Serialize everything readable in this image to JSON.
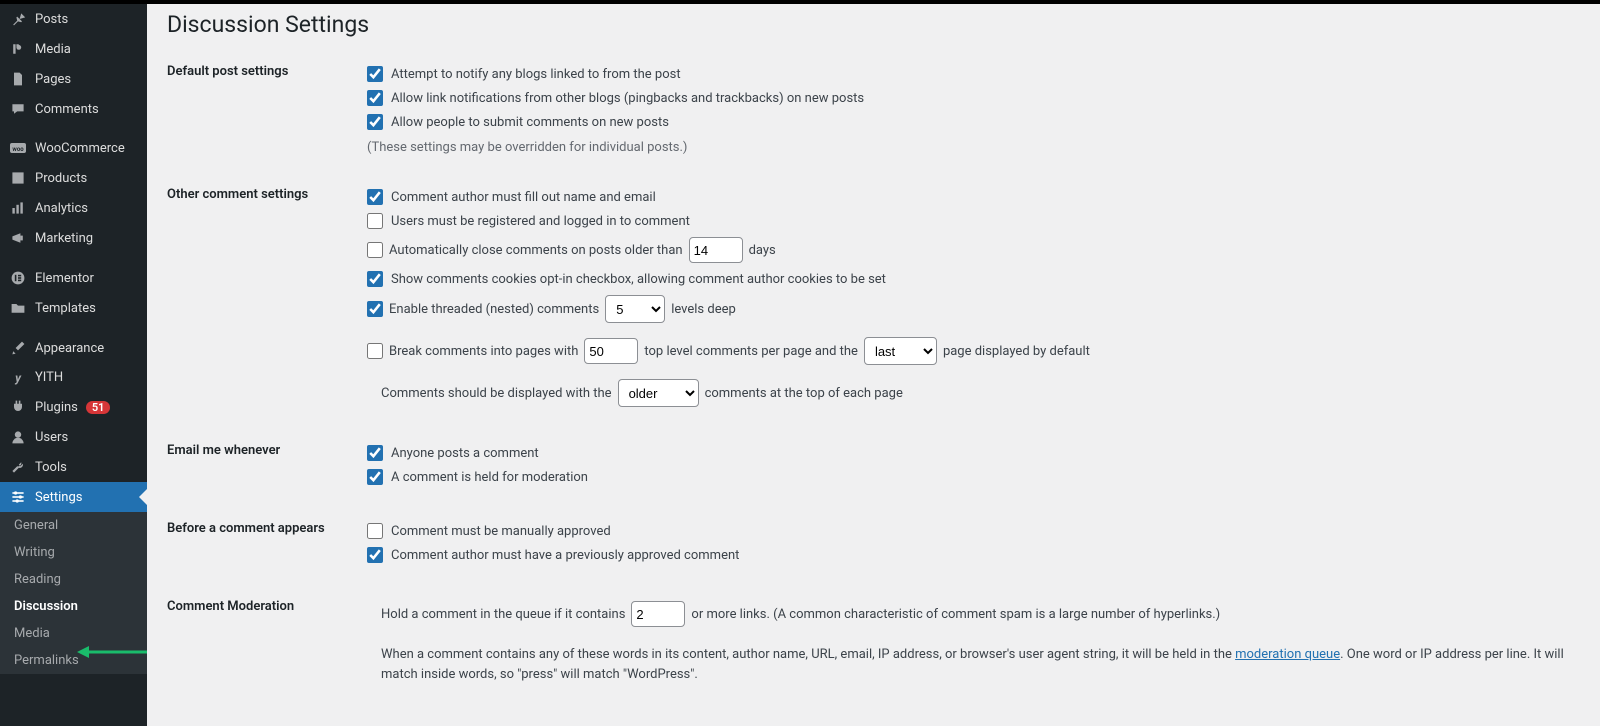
{
  "sidebar": {
    "items": [
      {
        "icon": "pin",
        "label": "Posts"
      },
      {
        "icon": "media",
        "label": "Media"
      },
      {
        "icon": "page",
        "label": "Pages"
      },
      {
        "icon": "comment",
        "label": "Comments"
      }
    ],
    "items2": [
      {
        "icon": "woo",
        "label": "WooCommerce"
      },
      {
        "icon": "products",
        "label": "Products"
      },
      {
        "icon": "analytics",
        "label": "Analytics"
      },
      {
        "icon": "marketing",
        "label": "Marketing"
      }
    ],
    "items3": [
      {
        "icon": "elementor",
        "label": "Elementor"
      },
      {
        "icon": "templates",
        "label": "Templates"
      }
    ],
    "items4": [
      {
        "icon": "appearance",
        "label": "Appearance"
      },
      {
        "icon": "yith",
        "label": "YITH"
      },
      {
        "icon": "plugins",
        "label": "Plugins",
        "badge": "51"
      },
      {
        "icon": "users",
        "label": "Users"
      },
      {
        "icon": "tools",
        "label": "Tools"
      }
    ],
    "settings": {
      "label": "Settings"
    },
    "sub": [
      "General",
      "Writing",
      "Reading",
      "Discussion",
      "Media",
      "Permalinks"
    ],
    "sub_current": "Discussion"
  },
  "page": {
    "title": "Discussion Settings"
  },
  "sections": {
    "default_post": {
      "label": "Default post settings",
      "opts": [
        {
          "checked": true,
          "text": "Attempt to notify any blogs linked to from the post"
        },
        {
          "checked": true,
          "text": "Allow link notifications from other blogs (pingbacks and trackbacks) on new posts"
        },
        {
          "checked": true,
          "text": "Allow people to submit comments on new posts"
        }
      ],
      "desc": "(These settings may be overridden for individual posts.)"
    },
    "other": {
      "label": "Other comment settings",
      "name_email": {
        "checked": true,
        "text": "Comment author must fill out name and email"
      },
      "registered": {
        "checked": false,
        "text": "Users must be registered and logged in to comment"
      },
      "autoclose": {
        "checked": false,
        "pre": "Automatically close comments on posts older than",
        "value": "14",
        "post": "days"
      },
      "cookies": {
        "checked": true,
        "text": "Show comments cookies opt-in checkbox, allowing comment author cookies to be set"
      },
      "threaded": {
        "checked": true,
        "pre": "Enable threaded (nested) comments",
        "value": "5",
        "post": "levels deep"
      },
      "pages": {
        "checked": false,
        "pre": "Break comments into pages with",
        "value": "50",
        "mid": "top level comments per page and the",
        "sel": "last",
        "post": "page displayed by default"
      },
      "order": {
        "pre": "Comments should be displayed with the",
        "sel": "older",
        "post": "comments at the top of each page"
      }
    },
    "email": {
      "label": "Email me whenever",
      "opts": [
        {
          "checked": true,
          "text": "Anyone posts a comment"
        },
        {
          "checked": true,
          "text": "A comment is held for moderation"
        }
      ]
    },
    "before": {
      "label": "Before a comment appears",
      "opts": [
        {
          "checked": false,
          "text": "Comment must be manually approved"
        },
        {
          "checked": true,
          "text": "Comment author must have a previously approved comment"
        }
      ]
    },
    "moderation": {
      "label": "Comment Moderation",
      "hold_pre": "Hold a comment in the queue if it contains",
      "hold_value": "2",
      "hold_post": "or more links. (A common characteristic of comment spam is a large number of hyperlinks.)",
      "long_pre": "When a comment contains any of these words in its content, author name, URL, email, IP address, or browser's user agent string, it will be held in the ",
      "link": "moderation queue",
      "long_post": ". One word or IP address per line. It will match inside words, so \"press\" will match \"WordPress\"."
    }
  }
}
